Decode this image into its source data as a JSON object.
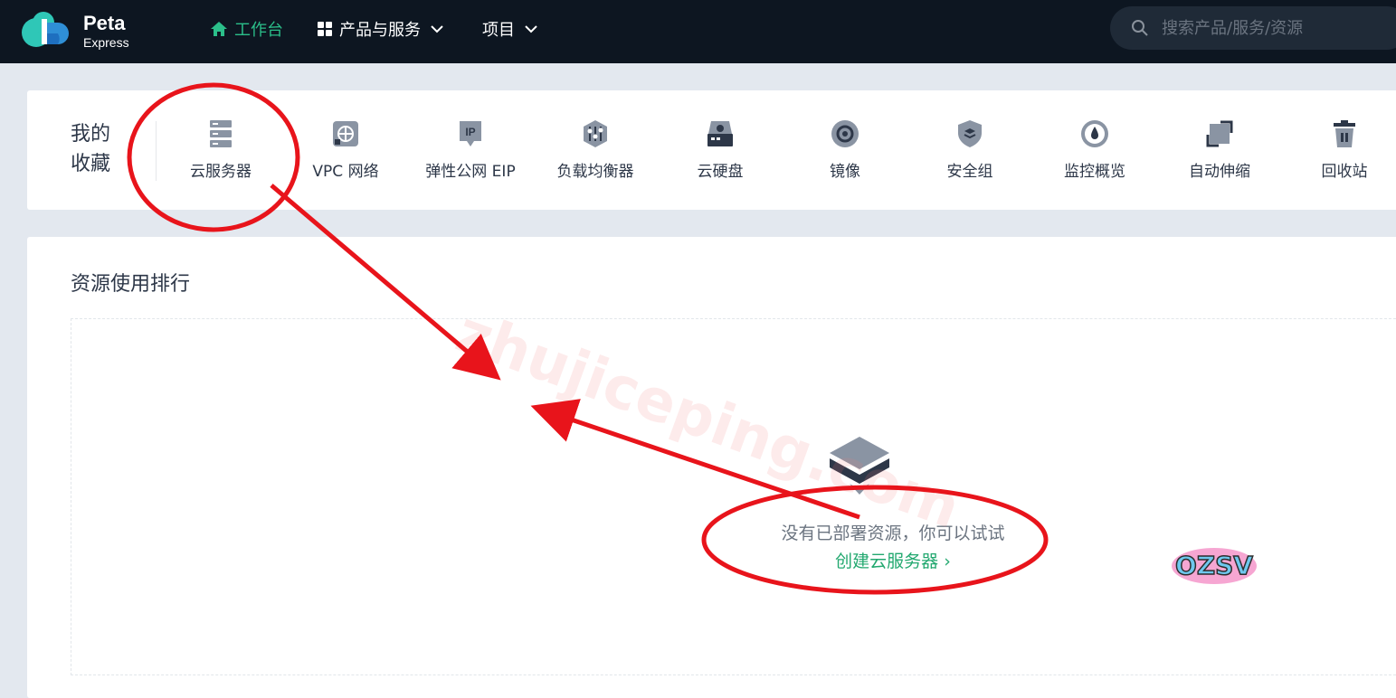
{
  "brand": {
    "name": "Peta",
    "sub": "Express"
  },
  "nav": {
    "workbench": "工作台",
    "products": "产品与服务",
    "projects": "项目"
  },
  "search": {
    "placeholder": "搜索产品/服务/资源"
  },
  "favorites": {
    "title": "我的收藏",
    "items": [
      {
        "label": "云服务器",
        "icon": "server-icon"
      },
      {
        "label": "VPC 网络",
        "icon": "network-icon"
      },
      {
        "label": "弹性公网 EIP",
        "icon": "ip-icon"
      },
      {
        "label": "负载均衡器",
        "icon": "load-balancer-icon"
      },
      {
        "label": "云硬盘",
        "icon": "disk-icon"
      },
      {
        "label": "镜像",
        "icon": "image-icon"
      },
      {
        "label": "安全组",
        "icon": "shield-icon"
      },
      {
        "label": "监控概览",
        "icon": "gauge-icon"
      },
      {
        "label": "自动伸缩",
        "icon": "scale-icon"
      },
      {
        "label": "回收站",
        "icon": "trash-icon"
      }
    ]
  },
  "resources": {
    "title": "资源使用排行",
    "empty_text": "没有已部署资源，你可以试试",
    "create_link": "创建云服务器 ›"
  },
  "sticker_text": "OZSV",
  "watermark": "zhujiceping.com",
  "colors": {
    "accent": "#2bbf8a",
    "link": "#22a86f",
    "annotation": "#e8141b"
  }
}
